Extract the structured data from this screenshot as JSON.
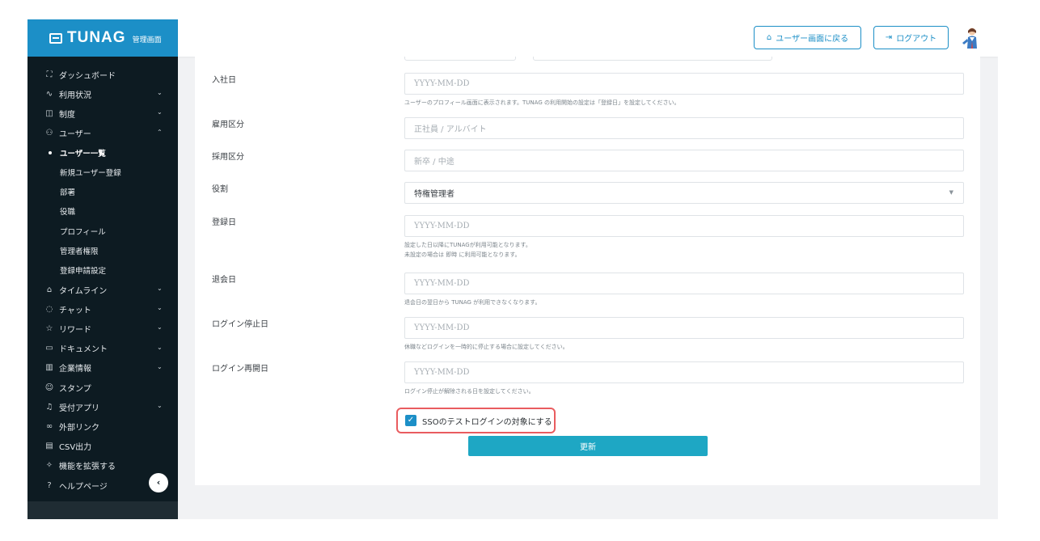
{
  "brand": {
    "logo_text": "TUNAG",
    "sub_label": "管理画面"
  },
  "sidebar": {
    "items": [
      {
        "label": "ダッシュボード",
        "icon": "chart-line-icon",
        "glyph": "⛶"
      },
      {
        "label": "利用状況",
        "icon": "activity-icon",
        "glyph": "∿",
        "chevron": "⌄"
      },
      {
        "label": "制度",
        "icon": "book-icon",
        "glyph": "◫",
        "chevron": "⌄"
      },
      {
        "label": "ユーザー",
        "icon": "users-icon",
        "glyph": "⚇",
        "chevron": "⌃"
      },
      {
        "label": "ユーザー一覧",
        "sub": true,
        "active": true
      },
      {
        "label": "新規ユーザー登録",
        "sub": true
      },
      {
        "label": "部署",
        "sub": true
      },
      {
        "label": "役職",
        "sub": true
      },
      {
        "label": "プロフィール",
        "sub": true
      },
      {
        "label": "管理者権限",
        "sub": true
      },
      {
        "label": "登録申請設定",
        "sub": true
      },
      {
        "label": "タイムライン",
        "icon": "home-icon",
        "glyph": "⌂",
        "chevron": "⌄"
      },
      {
        "label": "チャット",
        "icon": "chat-bubble-icon",
        "glyph": "◌",
        "chevron": "⌄"
      },
      {
        "label": "リワード",
        "icon": "star-icon",
        "glyph": "☆",
        "chevron": "⌄"
      },
      {
        "label": "ドキュメント",
        "icon": "folder-icon",
        "glyph": "▭",
        "chevron": "⌄"
      },
      {
        "label": "企業情報",
        "icon": "building-icon",
        "glyph": "▥",
        "chevron": "⌄"
      },
      {
        "label": "スタンプ",
        "icon": "smile-icon",
        "glyph": "☺"
      },
      {
        "label": "受付アプリ",
        "icon": "bell-icon",
        "glyph": "♫",
        "chevron": "⌄"
      },
      {
        "label": "外部リンク",
        "icon": "link-icon",
        "glyph": "∞"
      },
      {
        "label": "CSV出力",
        "icon": "table-icon",
        "glyph": "▤"
      },
      {
        "label": "機能を拡張する",
        "icon": "puzzle-icon",
        "glyph": "✧"
      },
      {
        "label": "ヘルプページ",
        "icon": "help-icon",
        "glyph": "?"
      }
    ],
    "collapse_glyph": "‹"
  },
  "header": {
    "user_screen_button": "ユーザー画面に戻る",
    "user_screen_icon": "⌂",
    "logout_button": "ログアウト",
    "logout_icon": "⇥"
  },
  "form": {
    "fields": [
      {
        "label": "入社日",
        "placeholder": "YYYY-MM-DD",
        "help": [
          "ユーザーのプロフィール画面に表示されます。TUNAG の利用開始の設定は「登録日」を設定してください。"
        ]
      },
      {
        "label": "雇用区分",
        "placeholder": "正社員 / アルバイト"
      },
      {
        "label": "採用区分",
        "placeholder": "新卒 / 中途"
      },
      {
        "label": "役割",
        "value": "特権管理者",
        "select": true
      },
      {
        "label": "登録日",
        "placeholder": "YYYY-MM-DD",
        "help": [
          "設定した日以降にTUNAGが利用可能となります。",
          "未設定の場合は 即時 に利用可能となります。"
        ]
      },
      {
        "label": "退会日",
        "placeholder": "YYYY-MM-DD",
        "help": [
          "退会日の翌日から TUNAG が利用できなくなります。"
        ]
      },
      {
        "label": "ログイン停止日",
        "placeholder": "YYYY-MM-DD",
        "help": [
          "休職などログインを一時的に停止する場合に設定してください。"
        ]
      },
      {
        "label": "ログイン再開日",
        "placeholder": "YYYY-MM-DD",
        "help": [
          "ログイン停止が解除される日を設定してください。"
        ]
      }
    ],
    "sso_checkbox_label": "SSOのテストログインの対象にする",
    "sso_checked": true,
    "submit_label": "更新"
  },
  "colors": {
    "brand": "#1c8fc7",
    "sidebar_bg": "#0d1b22",
    "submit": "#1ea7c4",
    "highlight": "#e95c5f"
  }
}
